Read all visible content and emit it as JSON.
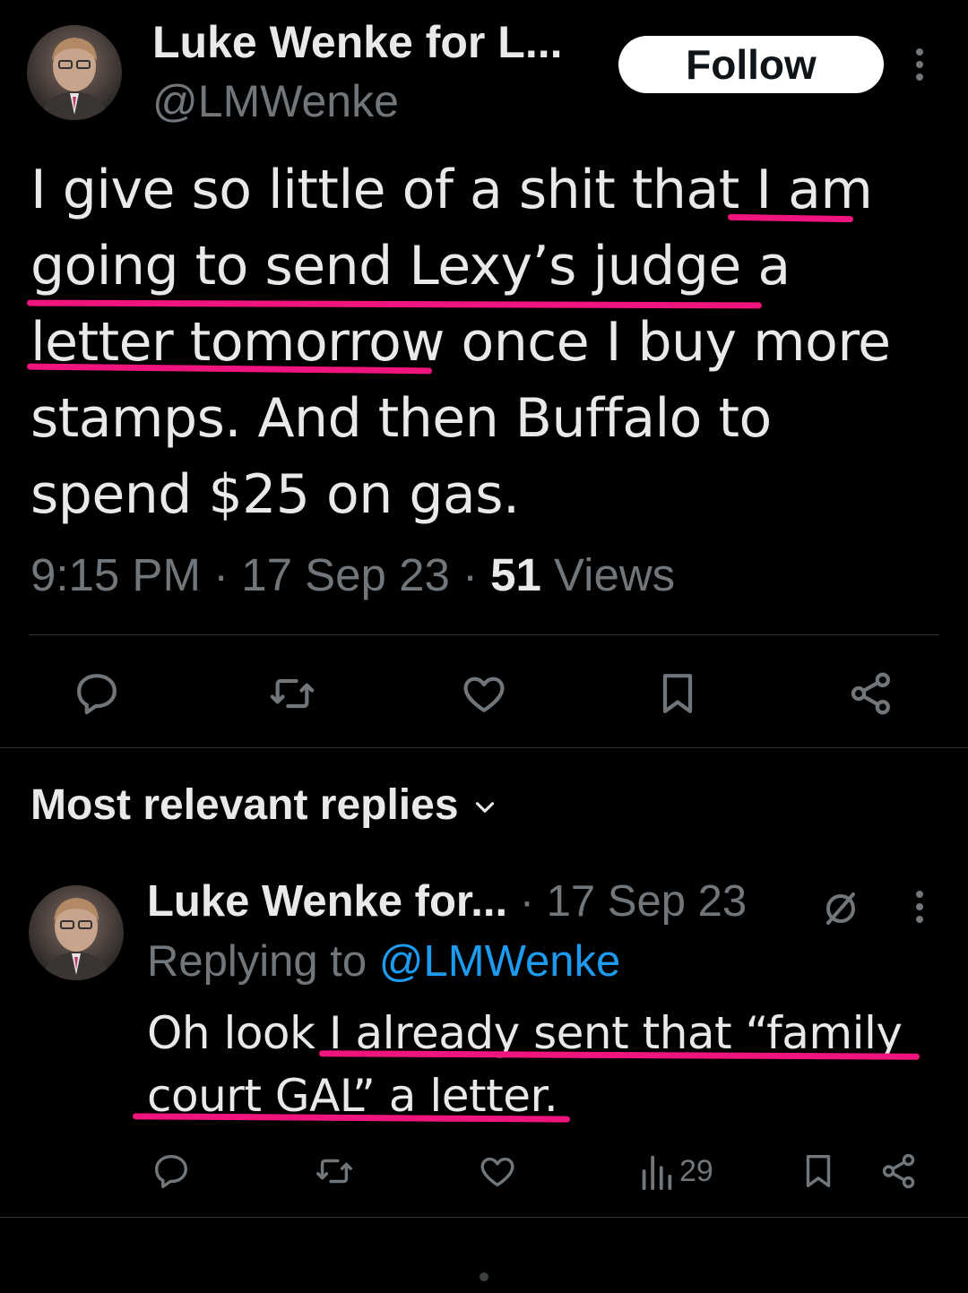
{
  "tweet": {
    "author_name": "Luke Wenke for L...",
    "author_handle": "@LMWenke",
    "follow_label": "Follow",
    "text_lines": [
      "I give so little of a shit that I am",
      "going to send Lexy’s judge a",
      "letter tomorrow once I buy more",
      "stamps.  And then Buffalo to",
      "spend $25 on gas."
    ],
    "time": "9:15 PM",
    "sep1": " · ",
    "date": "17 Sep 23",
    "sep2": " · ",
    "views_count": "51",
    "views_label": " Views"
  },
  "replies_header": {
    "label": "Most relevant replies"
  },
  "reply": {
    "author_name": "Luke Wenke for...",
    "sep": " · ",
    "date": "17 Sep 23",
    "replying_prefix": "Replying to ",
    "replying_handle": "@LMWenke",
    "text_lines": [
      "Oh look I already sent that “family",
      "court GAL” a letter."
    ],
    "views_count": "29"
  },
  "colors": {
    "background": "#000000",
    "text": "#e7e9ea",
    "muted": "#71767b",
    "link": "#1d9bf0",
    "highlight_underline": "#f0147e"
  }
}
